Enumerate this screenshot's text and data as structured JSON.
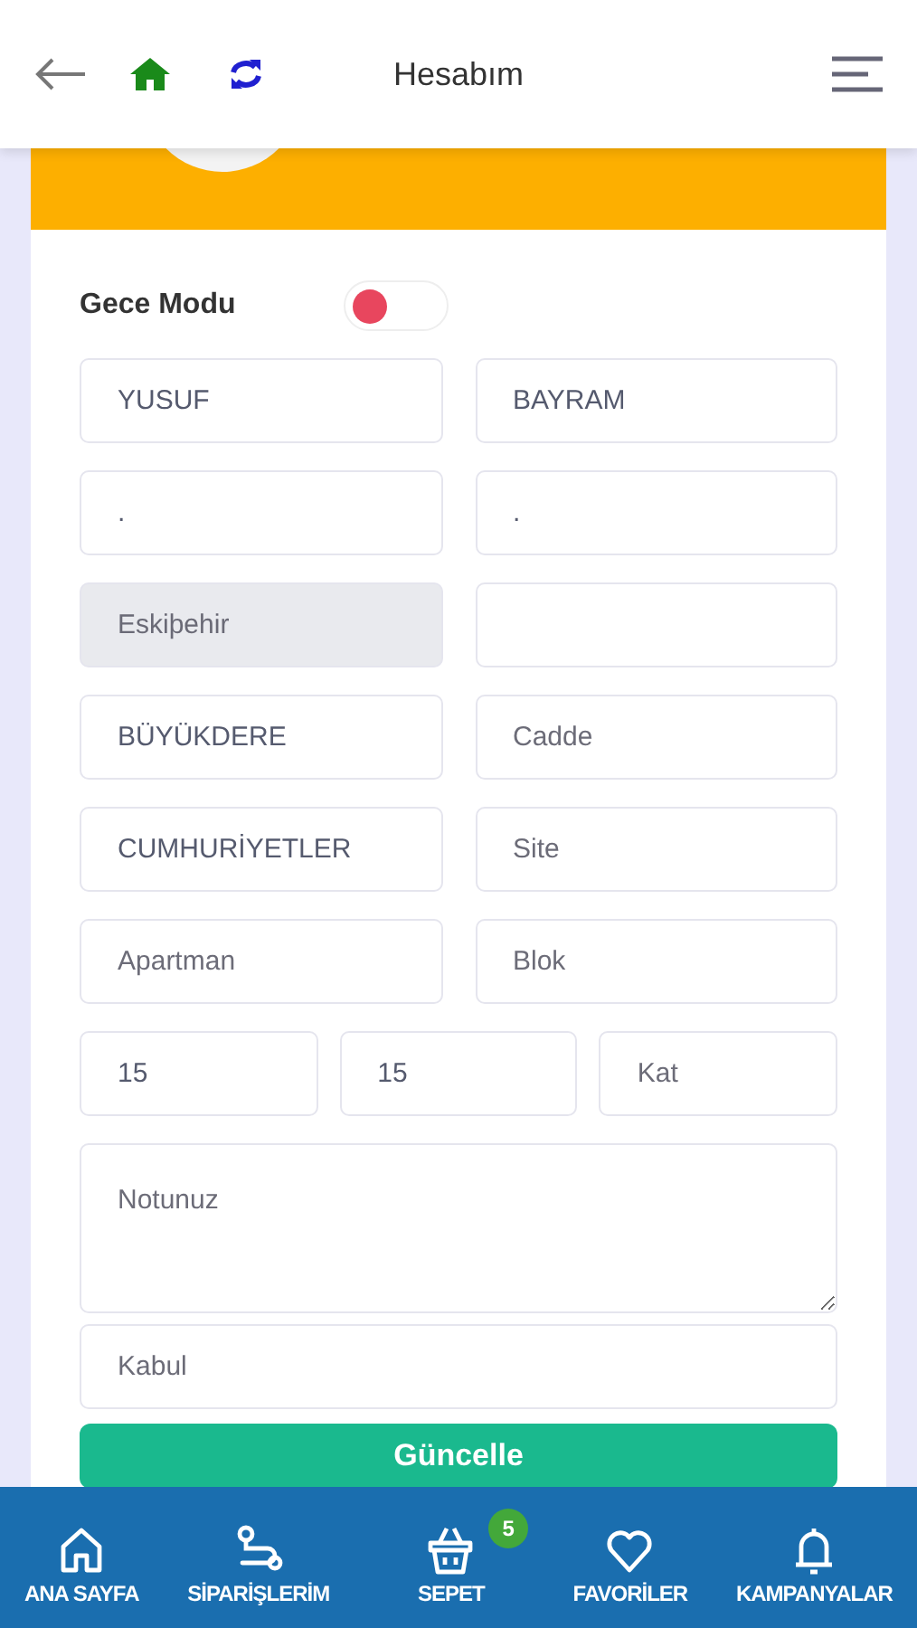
{
  "header": {
    "title": "Hesabım"
  },
  "dark_mode": {
    "label": "Gece Modu",
    "on": false
  },
  "form_rows": [
    [
      {
        "kind": "input",
        "value": "YUSUF",
        "disabled": false
      },
      {
        "kind": "input",
        "value": "BAYRAM",
        "disabled": false
      }
    ],
    [
      {
        "kind": "input",
        "value": ".",
        "disabled": false
      },
      {
        "kind": "input",
        "value": ".",
        "disabled": false
      }
    ],
    [
      {
        "kind": "input",
        "value": "Eskiþehir",
        "disabled": true
      },
      {
        "kind": "input",
        "disabled": false
      }
    ],
    [
      {
        "kind": "input",
        "value": "BÜYÜKDERE",
        "disabled": false
      },
      {
        "kind": "input",
        "placeholder": "Cadde",
        "disabled": false
      }
    ],
    [
      {
        "kind": "input",
        "value": "CUMHURİYETLER",
        "disabled": false
      },
      {
        "kind": "input",
        "placeholder": "Site",
        "disabled": false
      }
    ],
    [
      {
        "kind": "input",
        "placeholder": "Apartman",
        "disabled": false
      },
      {
        "kind": "input",
        "placeholder": "Blok",
        "disabled": false
      }
    ],
    [
      {
        "kind": "input",
        "value": "15",
        "disabled": false
      },
      {
        "kind": "input",
        "value": "15",
        "disabled": false
      },
      {
        "kind": "input",
        "placeholder": "Kat",
        "disabled": false
      }
    ],
    [
      {
        "kind": "textarea",
        "placeholder": "Notunuz",
        "disabled": false
      }
    ],
    [
      {
        "kind": "input",
        "placeholder": "Kabul",
        "disabled": false
      }
    ]
  ],
  "submit_button": "Güncelle",
  "bottom_nav": [
    {
      "kind": "home",
      "label": "ANA SAYFA"
    },
    {
      "kind": "route",
      "label": "SİPARİŞLERİM"
    },
    {
      "kind": "basket",
      "label": "SEPET",
      "badge": "5"
    },
    {
      "kind": "heart",
      "label": "FAVORİLER"
    },
    {
      "kind": "bell",
      "label": "KAMPANYALAR"
    }
  ]
}
